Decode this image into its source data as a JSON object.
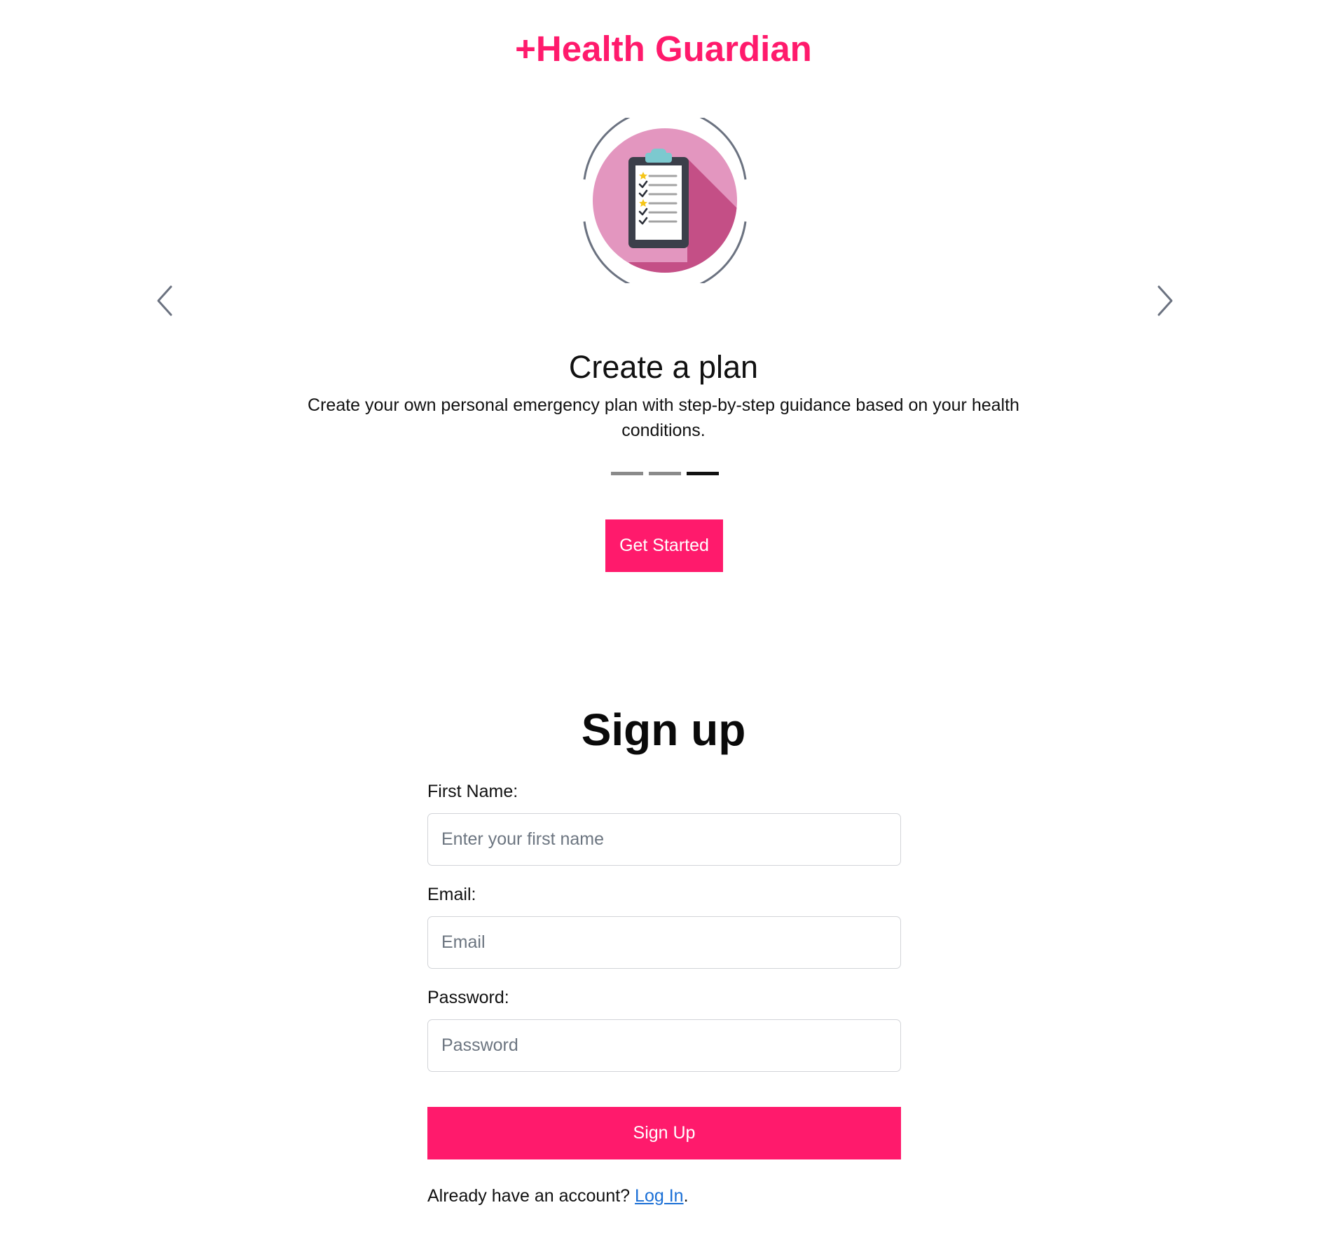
{
  "brand": {
    "title": "+Health Guardian",
    "color": "#ff1a6c"
  },
  "carousel": {
    "illustration_icon": "clipboard-checklist-icon",
    "prev_icon": "chevron-left-icon",
    "next_icon": "chevron-right-icon",
    "slide_title": "Create a plan",
    "slide_description": "Create your own personal emergency plan with step-by-step guidance based on your health conditions.",
    "slide_count": 3,
    "active_slide": 3,
    "cta_label": "Get Started"
  },
  "signup": {
    "title": "Sign up",
    "first_name_label": "First Name:",
    "first_name_placeholder": "Enter your first name",
    "first_name_value": "",
    "email_label": "Email:",
    "email_placeholder": "Email",
    "email_value": "",
    "password_label": "Password:",
    "password_placeholder": "Password",
    "password_value": "",
    "submit_label": "Sign Up",
    "login_prompt": "Already have an account? ",
    "login_link": "Log In",
    "login_suffix": "."
  },
  "colors": {
    "accent": "#ff1a6c",
    "link": "#1a6fd6",
    "indicator_inactive": "#8a8a8a",
    "indicator_active": "#111111"
  }
}
